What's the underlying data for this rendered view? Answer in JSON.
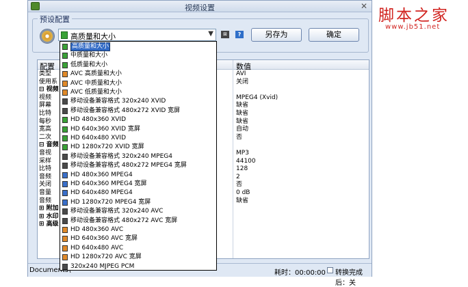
{
  "window": {
    "title": "视频设置"
  },
  "preset": {
    "group_label": "预设配置",
    "selected": "高质量和大小",
    "mini_btn_1": "⊠",
    "mini_btn_2": "?",
    "saveas_label": "另存为",
    "ok_label": "确定"
  },
  "grid": {
    "col_config": "配置",
    "col_value": "数值",
    "rows": [
      {
        "k": "类型",
        "v": "AVI"
      },
      {
        "k": "使用系",
        "v": "关闭"
      },
      {
        "k": "⊟ 视频",
        "v": ""
      },
      {
        "k": "视频",
        "v": "MPEG4 (Xvid)"
      },
      {
        "k": "屏幕",
        "v": "缺省"
      },
      {
        "k": "比特",
        "v": "缺省"
      },
      {
        "k": "每秒",
        "v": "缺省"
      },
      {
        "k": "宽高",
        "v": "自动"
      },
      {
        "k": "二次",
        "v": "否"
      },
      {
        "k": "⊟ 音频",
        "v": ""
      },
      {
        "k": "音视",
        "v": "MP3"
      },
      {
        "k": "采样",
        "v": "44100"
      },
      {
        "k": "比特",
        "v": "128"
      },
      {
        "k": "音频",
        "v": "2"
      },
      {
        "k": "关闭",
        "v": "否"
      },
      {
        "k": "音量",
        "v": "0 dB"
      },
      {
        "k": "音频",
        "v": "缺省"
      },
      {
        "k": "⊞ 附加",
        "v": ""
      },
      {
        "k": "⊞ 水印",
        "v": ""
      },
      {
        "k": "⊞ 高级",
        "v": ""
      }
    ]
  },
  "statusbar": {
    "path": "Documents\\",
    "time": "耗时：00:00:00",
    "after": "转换完成后：关"
  },
  "dropdown": {
    "items": [
      {
        "label": "高质量和大小",
        "color": "#3aa236"
      },
      {
        "label": "中质量和大小",
        "color": "#3aa236"
      },
      {
        "label": "低质量和大小",
        "color": "#3aa236"
      },
      {
        "label": "AVC 高质量和大小",
        "color": "#e08a2a"
      },
      {
        "label": "AVC 中质量和大小",
        "color": "#e08a2a"
      },
      {
        "label": "AVC 低质量和大小",
        "color": "#e08a2a"
      },
      {
        "label": "移动设备兼容格式 320x240 XVID",
        "color": "#4a4a4a"
      },
      {
        "label": "移动设备兼容格式 480x272 XVID 宽屏",
        "color": "#4a4a4a"
      },
      {
        "label": "HD 480x360 XVID",
        "color": "#3aa236"
      },
      {
        "label": "HD 640x360 XVID 宽屏",
        "color": "#3aa236"
      },
      {
        "label": "HD 640x480 XVID",
        "color": "#3aa236"
      },
      {
        "label": "HD 1280x720 XVID 宽屏",
        "color": "#3aa236"
      },
      {
        "label": "移动设备兼容格式 320x240 MPEG4",
        "color": "#4a4a4a"
      },
      {
        "label": "移动设备兼容格式 480x272 MPEG4 宽屏",
        "color": "#4a4a4a"
      },
      {
        "label": "HD 480x360 MPEG4",
        "color": "#3a6fc9"
      },
      {
        "label": "HD 640x360 MPEG4 宽屏",
        "color": "#3a6fc9"
      },
      {
        "label": "HD 640x480 MPEG4",
        "color": "#3a6fc9"
      },
      {
        "label": "HD 1280x720 MPEG4 宽屏",
        "color": "#3a6fc9"
      },
      {
        "label": "移动设备兼容格式 320x240 AVC",
        "color": "#4a4a4a"
      },
      {
        "label": "移动设备兼容格式 480x272 AVC 宽屏",
        "color": "#4a4a4a"
      },
      {
        "label": "HD 480x360 AVC",
        "color": "#e08a2a"
      },
      {
        "label": "HD 640x360 AVC 宽屏",
        "color": "#e08a2a"
      },
      {
        "label": "HD 640x480 AVC",
        "color": "#e08a2a"
      },
      {
        "label": "HD 1280x720 AVC 宽屏",
        "color": "#e08a2a"
      },
      {
        "label": "320x240 MJPEG PCM",
        "color": "#4a4a4a"
      }
    ]
  },
  "watermark": {
    "title": "脚本之家",
    "url": "www.jb51.net"
  }
}
